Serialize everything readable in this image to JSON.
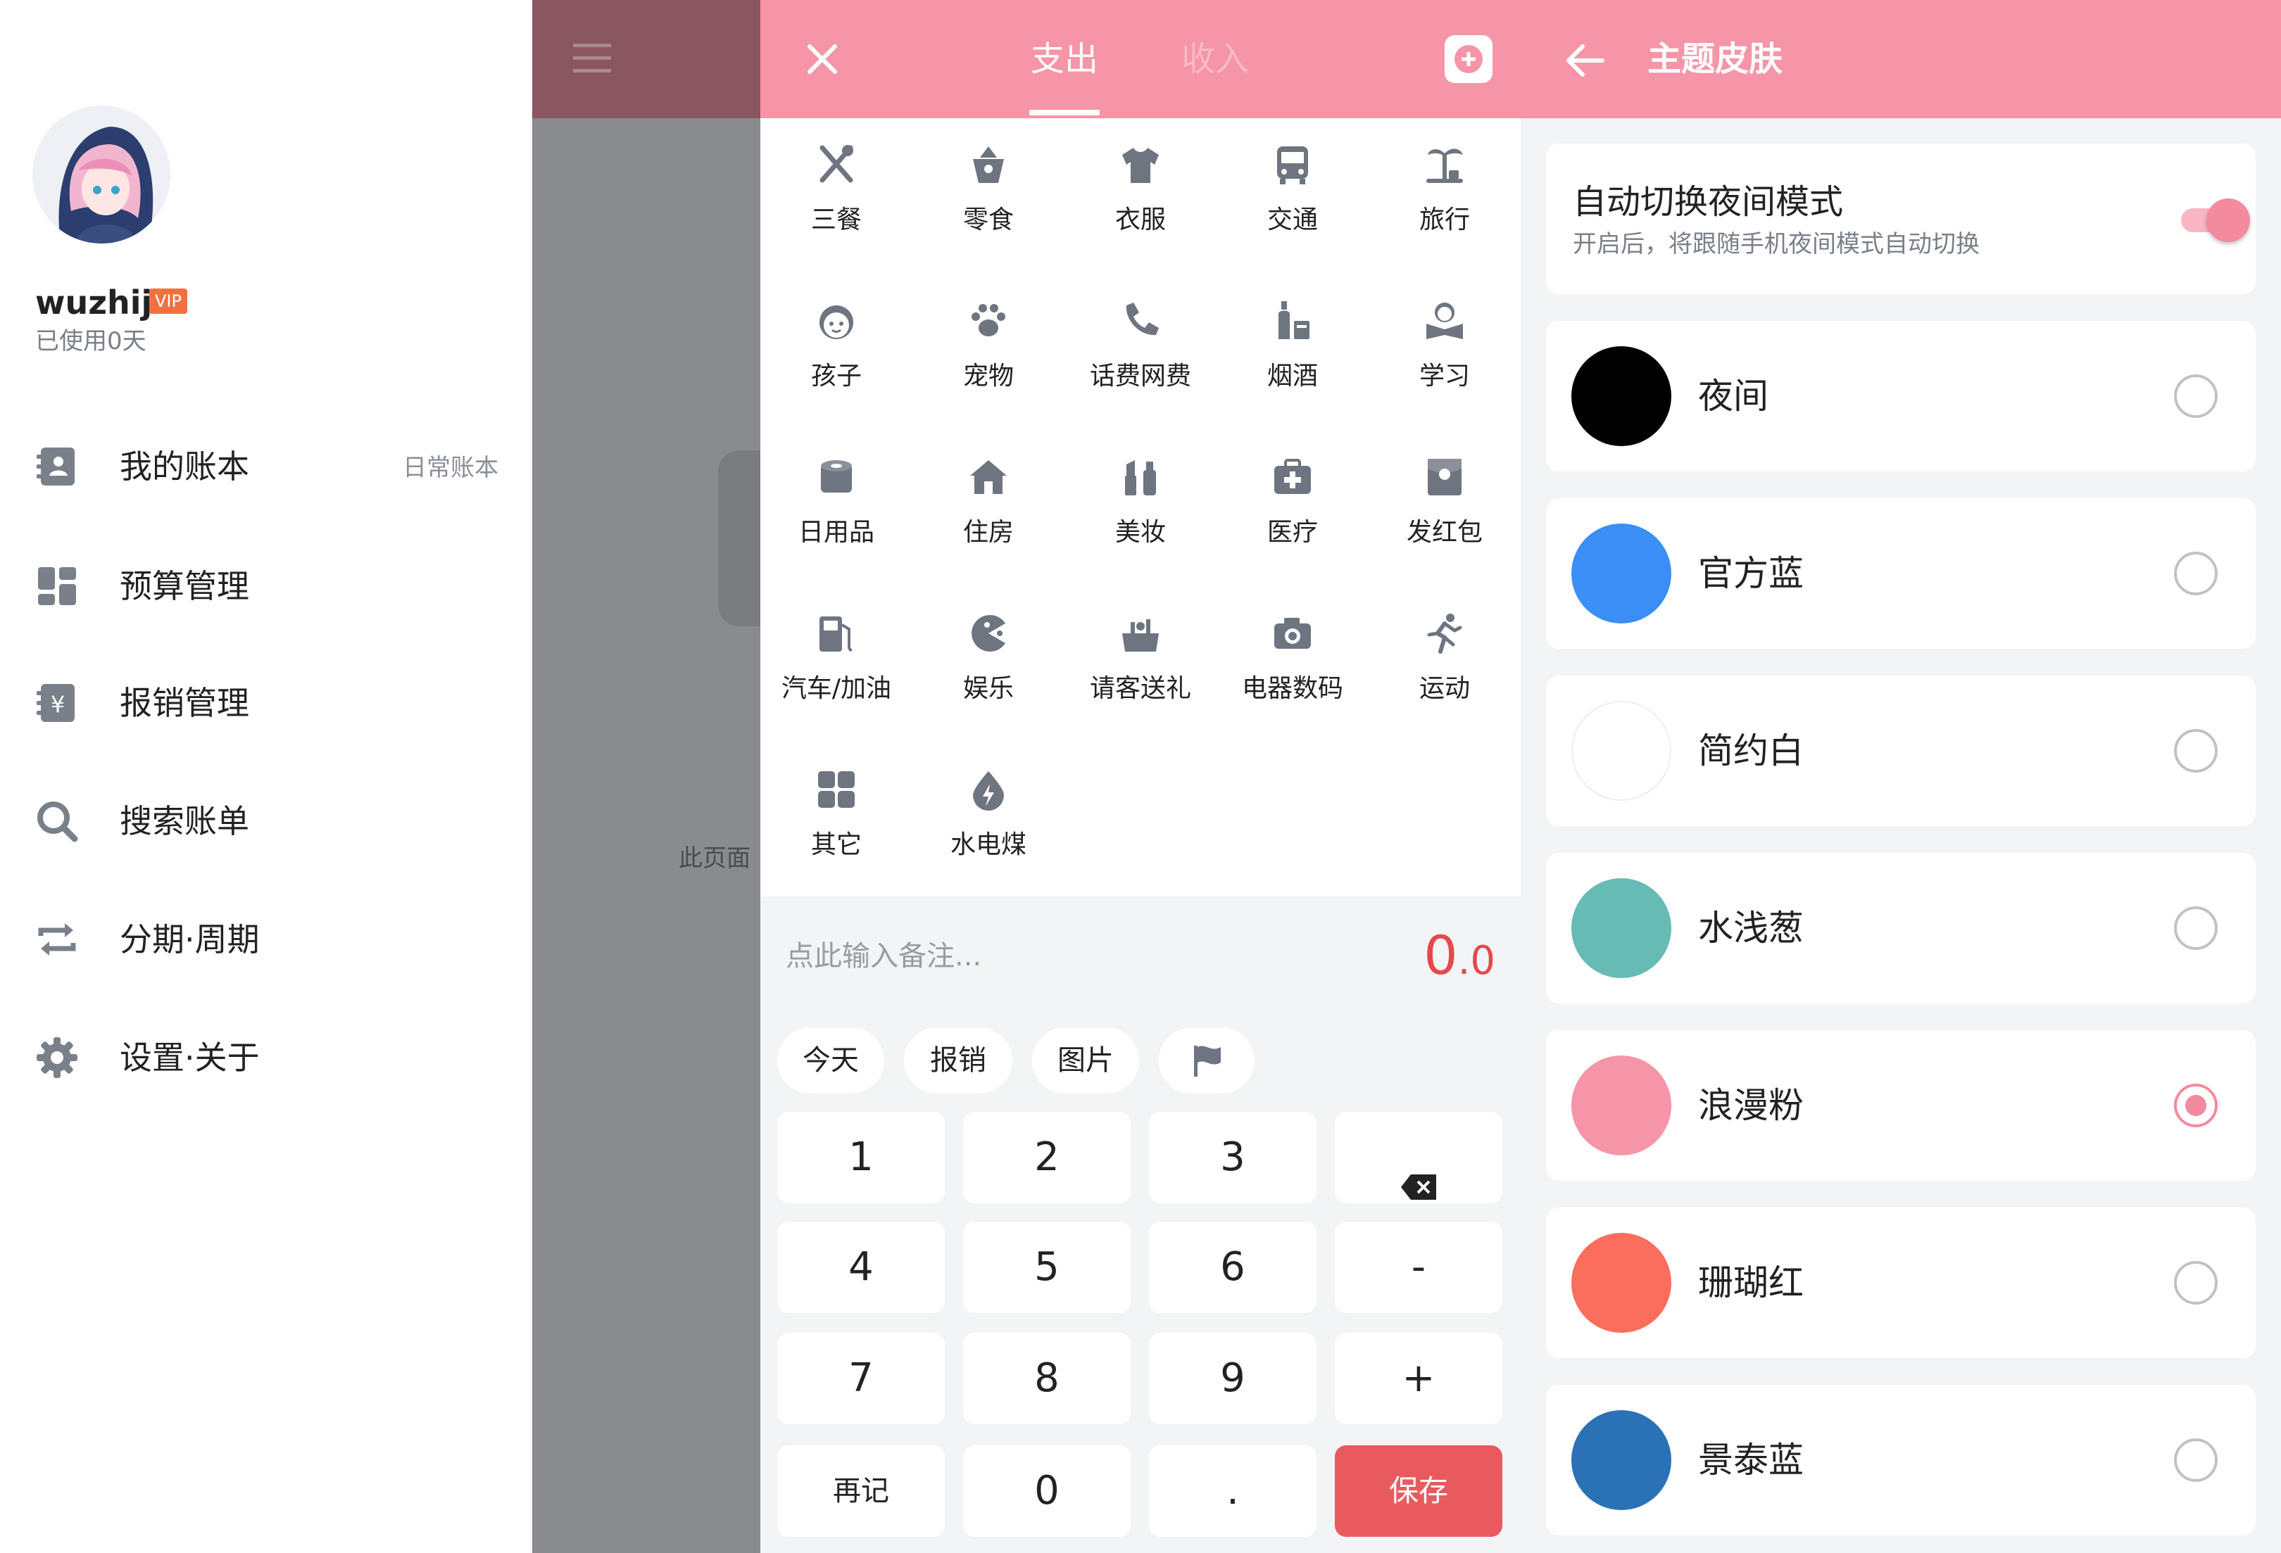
{
  "drawer": {
    "username": "wuzhij",
    "vip": "VIP",
    "used_days": "已使用0天",
    "menu": [
      {
        "label": "我的账本",
        "sub": "日常账本",
        "icon": "contacts-book-icon"
      },
      {
        "label": "预算管理",
        "icon": "dashboard-grid-icon"
      },
      {
        "label": "报销管理",
        "icon": "yen-notebook-icon"
      },
      {
        "label": "搜索账单",
        "icon": "search-icon"
      },
      {
        "label": "分期·周期",
        "icon": "repeat-icon"
      },
      {
        "label": "设置·关于",
        "icon": "gear-icon"
      }
    ]
  },
  "background_page": {
    "text": "此页面"
  },
  "add_record": {
    "tabs": {
      "expense": "支出",
      "income": "收入"
    },
    "categories": [
      "三餐",
      "零食",
      "衣服",
      "交通",
      "旅行",
      "孩子",
      "宠物",
      "话费网费",
      "烟酒",
      "学习",
      "日用品",
      "住房",
      "美妆",
      "医疗",
      "发红包",
      "汽车/加油",
      "娱乐",
      "请客送礼",
      "电器数码",
      "运动",
      "其它",
      "水电煤"
    ],
    "note_placeholder": "点此输入备注...",
    "amount_int": "0",
    "amount_dec": ".0",
    "chips": [
      "今天",
      "报销",
      "图片"
    ],
    "keys": {
      "k1": "1",
      "k2": "2",
      "k3": "3",
      "k4": "4",
      "k5": "5",
      "k6": "6",
      "minus": "-",
      "k7": "7",
      "k8": "8",
      "k9": "9",
      "plus": "+",
      "again": "再记",
      "k0": "0",
      "dot": ".",
      "save": "保存"
    }
  },
  "theme": {
    "title": "主题皮肤",
    "auto_night": {
      "title": "自动切换夜间模式",
      "subtitle": "开启后，将跟随手机夜间模式自动切换",
      "enabled": true
    },
    "options": [
      {
        "name": "夜间",
        "color": "#000000",
        "selected": false
      },
      {
        "name": "官方蓝",
        "color": "#3a8ef5",
        "selected": false
      },
      {
        "name": "简约白",
        "color": "#ffffff",
        "selected": false
      },
      {
        "name": "水浅葱",
        "color": "#66bbb5",
        "selected": false
      },
      {
        "name": "浪漫粉",
        "color": "#f595a7",
        "selected": true
      },
      {
        "name": "珊瑚红",
        "color": "#fb6d5c",
        "selected": false
      },
      {
        "name": "景泰蓝",
        "color": "#2a72b5",
        "selected": false
      }
    ]
  },
  "colors": {
    "accent": "#f595a7",
    "amount": "#e5484d",
    "save": "#e95a5f"
  }
}
